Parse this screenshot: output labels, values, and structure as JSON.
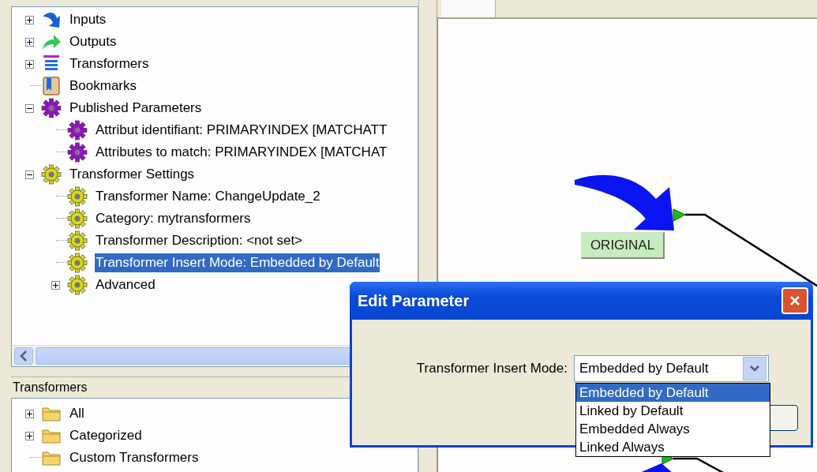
{
  "navigator": {
    "tree": [
      {
        "label": "Inputs",
        "kind": "input",
        "expanded": false,
        "selected": false
      },
      {
        "label": "Outputs",
        "kind": "output",
        "expanded": false,
        "selected": false
      },
      {
        "label": "Transformers",
        "kind": "stack",
        "expanded": false,
        "selected": false
      },
      {
        "label": "Bookmarks",
        "kind": "bookmark",
        "selected": false
      },
      {
        "label": "Published Parameters",
        "kind": "param",
        "expanded": true,
        "selected": false,
        "children": [
          {
            "label": "Attribut identifiant: PRIMARYINDEX [MATCHATT",
            "kind": "param",
            "selected": false
          },
          {
            "label": "Attributes to match: PRIMARYINDEX [MATCHAT",
            "kind": "param",
            "selected": false
          }
        ]
      },
      {
        "label": "Transformer Settings",
        "kind": "setting",
        "expanded": true,
        "selected": false,
        "children": [
          {
            "label": "Transformer Name: ChangeUpdate_2",
            "kind": "setting",
            "selected": false
          },
          {
            "label": "Category: mytransformers",
            "kind": "setting",
            "selected": false
          },
          {
            "label": "Transformer Description: <not set>",
            "kind": "setting",
            "selected": false
          },
          {
            "label": "Transformer Insert Mode: Embedded by Default",
            "kind": "setting",
            "selected": true
          },
          {
            "label": "Advanced",
            "kind": "setting",
            "expanded": false,
            "selected": false
          }
        ]
      }
    ]
  },
  "gallery": {
    "title": "Transformers",
    "tree": [
      {
        "label": "All",
        "kind": "folder",
        "expanded": false,
        "selected": false
      },
      {
        "label": "Categorized",
        "kind": "folder",
        "expanded": false,
        "selected": false
      },
      {
        "label": "Custom Transformers",
        "kind": "folder",
        "selected": false
      }
    ]
  },
  "canvas": {
    "nodes": [
      {
        "label": "ORIGINAL"
      }
    ]
  },
  "dialog": {
    "title": "Edit Parameter",
    "field_label": "Transformer Insert Mode:",
    "value": "Embedded by Default",
    "options": [
      {
        "label": "Embedded by Default",
        "selected": true
      },
      {
        "label": "Linked by Default",
        "selected": false
      },
      {
        "label": "Embedded Always",
        "selected": false
      },
      {
        "label": "Linked Always",
        "selected": false
      }
    ]
  }
}
